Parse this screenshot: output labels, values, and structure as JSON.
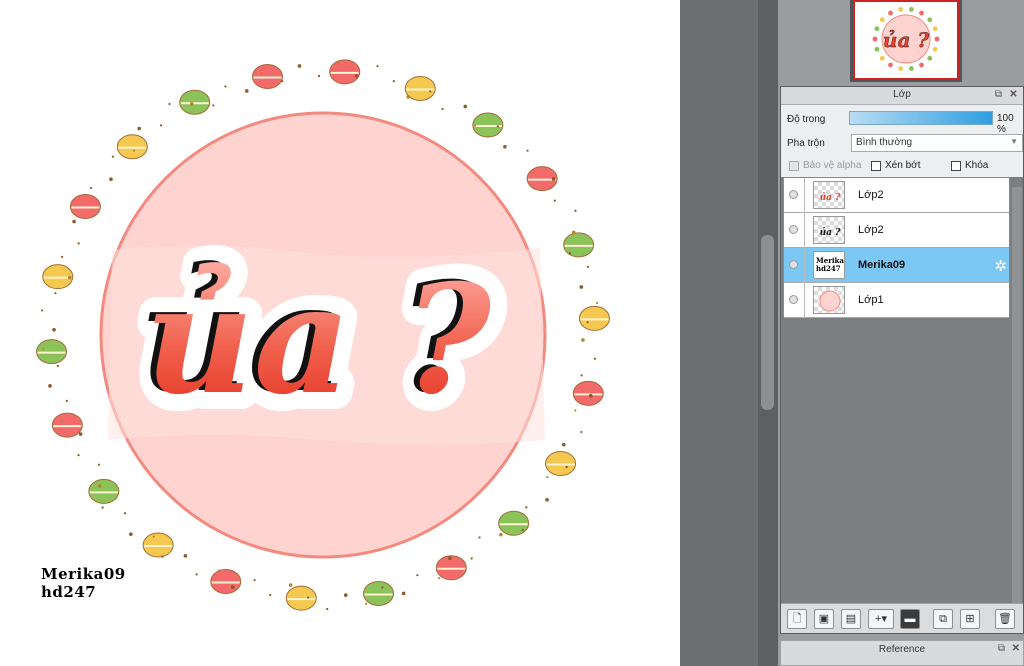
{
  "canvas": {
    "artwork_text": "ủa ?",
    "signature_line1": "Merika09",
    "signature_line2": "hd247"
  },
  "layer_panel": {
    "title": "Lớp",
    "float_icon": "float-window-icon",
    "close_icon": "close-icon",
    "opacity_label": "Độ trong",
    "opacity_value": "100 %",
    "opacity_fraction": 1.0,
    "blend_label": "Pha trộn",
    "blend_value": "Bình thường",
    "checkbox_alpha": "Bảo vệ alpha",
    "checkbox_clip": "Xén bớt",
    "checkbox_lock": "Khóa",
    "layers": [
      {
        "name": "Lớp2",
        "selected": false
      },
      {
        "name": "Lớp2",
        "selected": false
      },
      {
        "name": "Merika09",
        "selected": true
      },
      {
        "name": "Lớp1",
        "selected": false
      }
    ]
  },
  "reference_panel": {
    "title": "Reference"
  },
  "colors": {
    "circle_fill": "#ffd2cf",
    "circle_border": "#f28a80",
    "text_red": "#e8402e",
    "selected_row": "#7cc8f5"
  }
}
